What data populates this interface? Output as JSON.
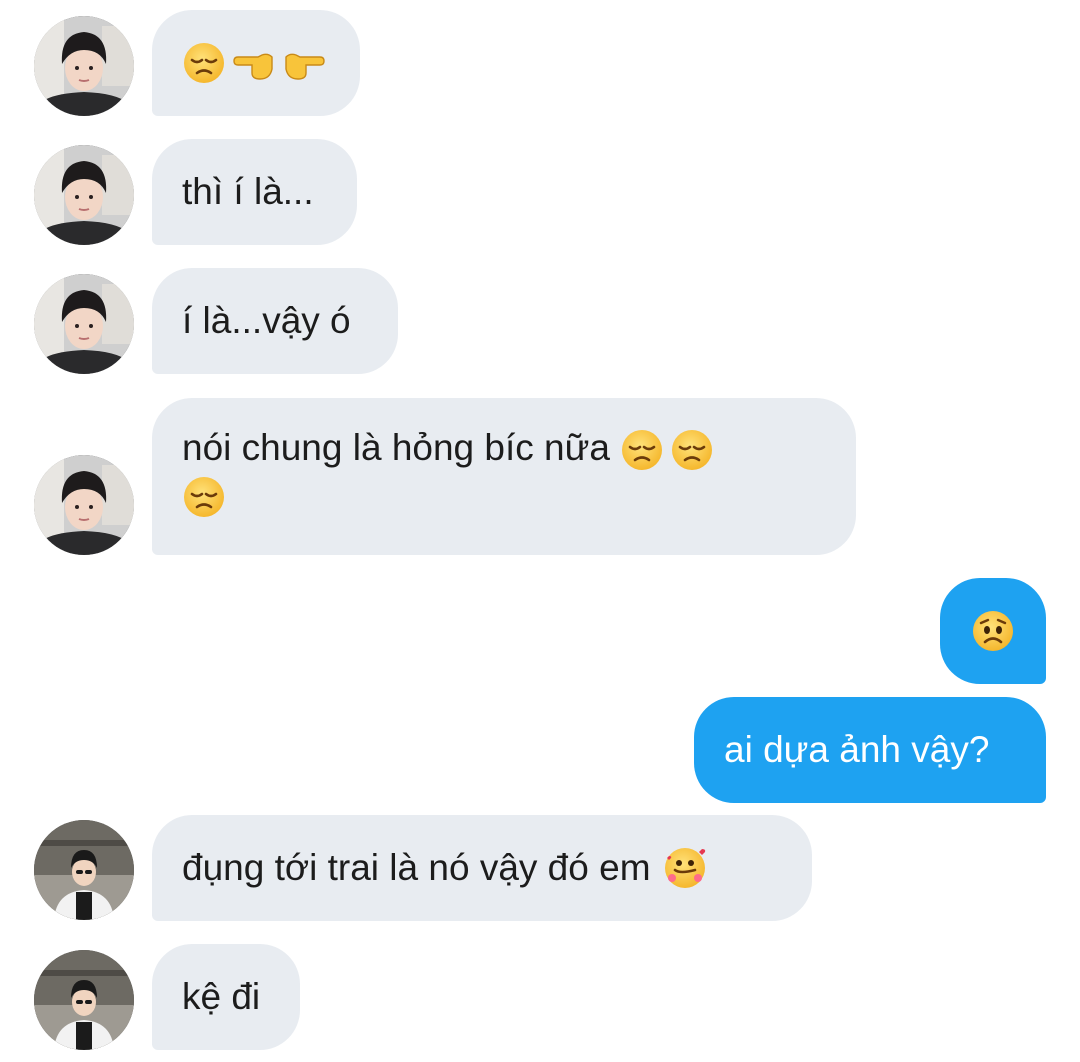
{
  "messages": [
    {
      "sender": "A",
      "text": "",
      "emoji": [
        "pensive-face",
        "hand-point-left",
        "hand-point-right"
      ]
    },
    {
      "sender": "A",
      "text": "thì í là..."
    },
    {
      "sender": "A",
      "text": "í là...vậy ó"
    },
    {
      "sender": "A",
      "text": "nói chung là hỏng bíc nữa",
      "emoji": [
        "pensive-face",
        "pensive-face",
        "pensive-face"
      ]
    },
    {
      "sender": "me",
      "text": "",
      "emoji": [
        "worried-face"
      ]
    },
    {
      "sender": "me",
      "text": "ai dựa ảnh vậy?"
    },
    {
      "sender": "B",
      "text": "đụng tới trai là nó vậy đó em",
      "emoji": [
        "smiling-face-with-hearts"
      ]
    },
    {
      "sender": "B",
      "text": "kệ đi"
    }
  ],
  "colors": {
    "incoming_bubble": "#e8ecf1",
    "outgoing_bubble": "#1ea2f1",
    "incoming_text": "#1c1c1c",
    "outgoing_text": "#ffffff"
  }
}
